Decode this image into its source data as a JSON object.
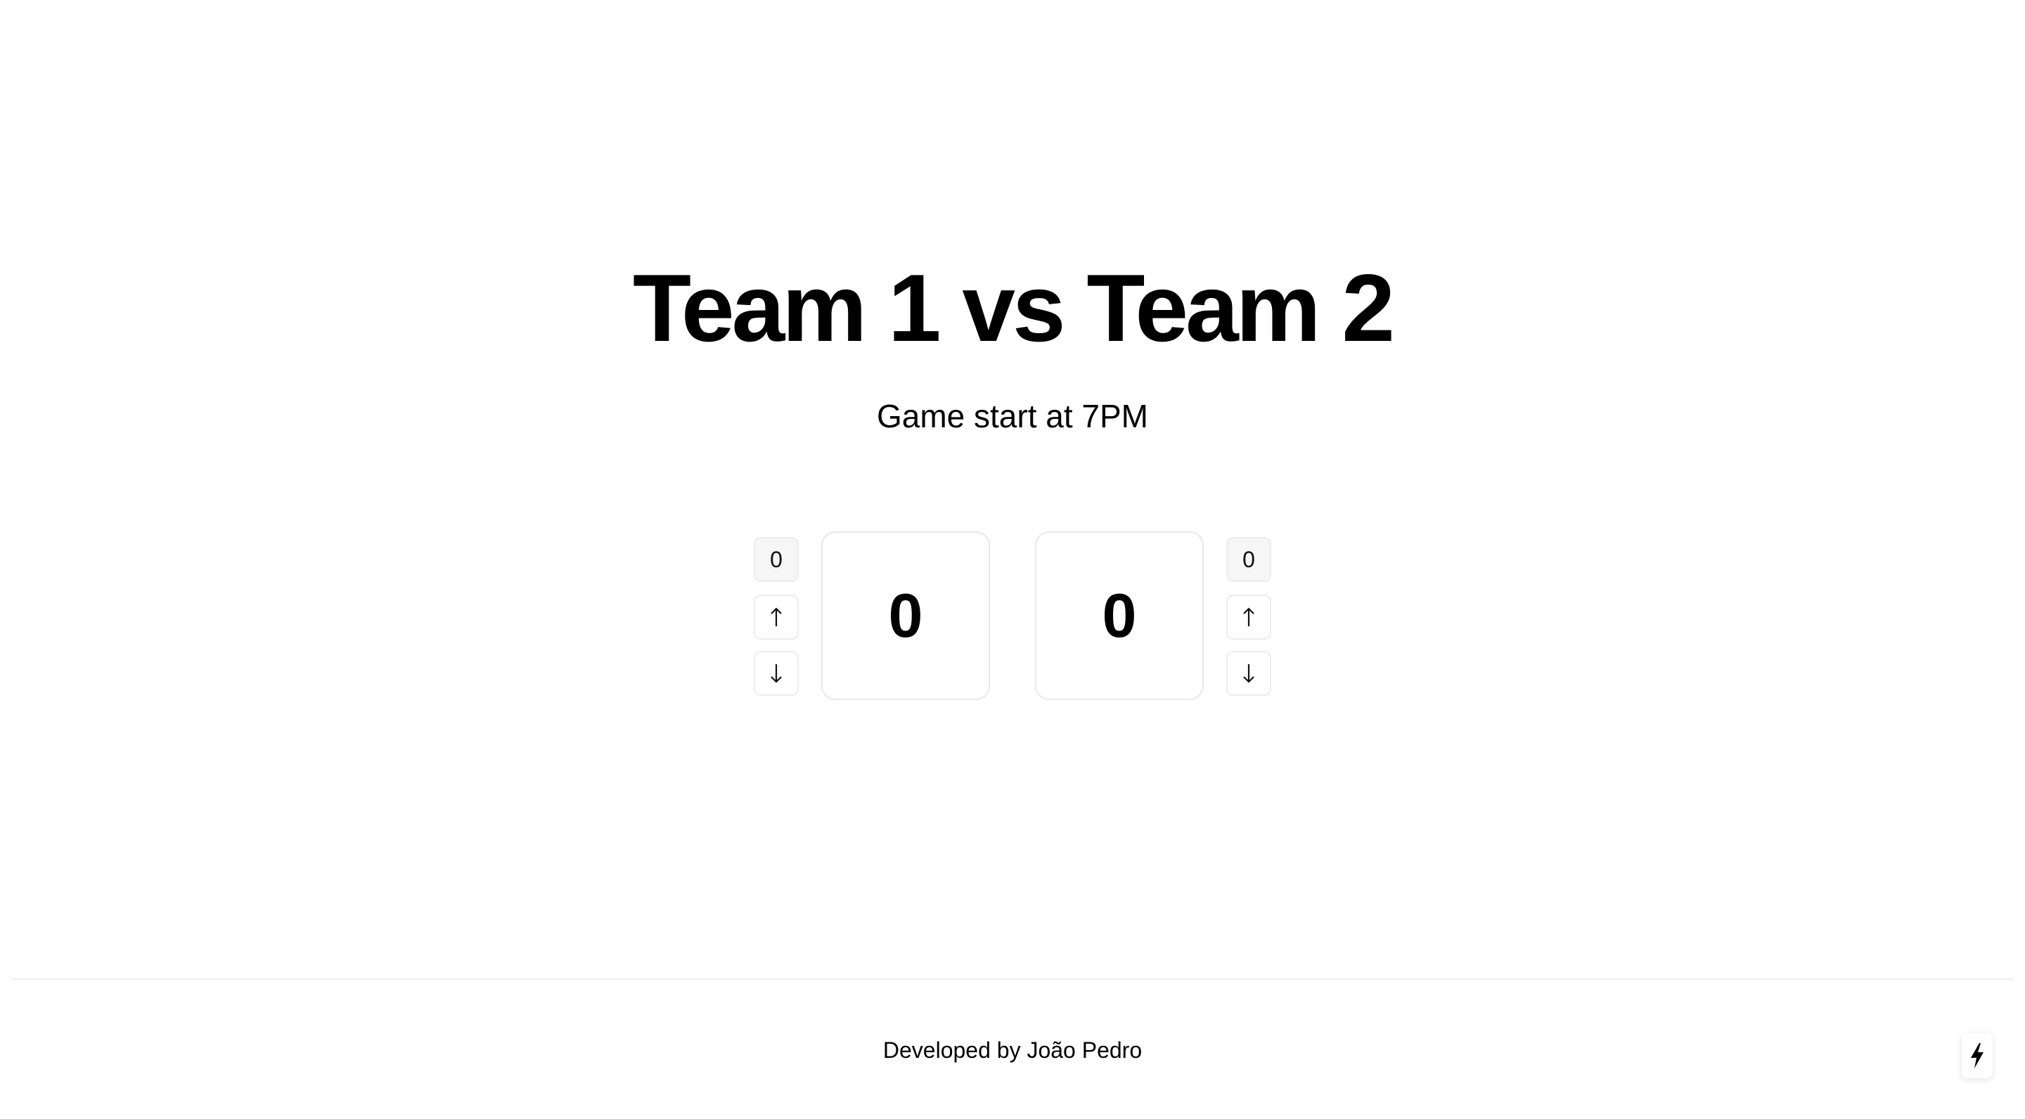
{
  "header": {
    "title": "Team 1 vs Team 2",
    "subtitle": "Game start at 7PM"
  },
  "scoreboard": {
    "team1": {
      "counter_value": "0",
      "score": "0",
      "increment_icon": "arrow-up-icon",
      "decrement_icon": "arrow-down-icon"
    },
    "team2": {
      "counter_value": "0",
      "score": "0",
      "increment_icon": "arrow-up-icon",
      "decrement_icon": "arrow-down-icon"
    }
  },
  "footer": {
    "credit": "Developed by João Pedro"
  },
  "dev_indicator": {
    "icon": "lightning-bolt-icon"
  },
  "colors": {
    "text": "#000000",
    "background": "#ffffff",
    "border": "#e8e8e8",
    "counter_bg": "#f6f6f6"
  }
}
